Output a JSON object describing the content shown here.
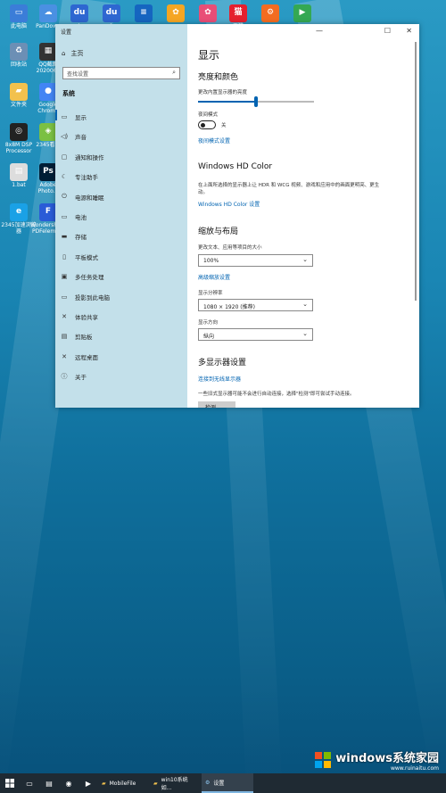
{
  "desktop": {
    "icons": [
      {
        "label": "此电脑",
        "icon": "computer-icon",
        "color": "#3b7dd8"
      },
      {
        "label": "PanDown",
        "icon": "cloud-icon",
        "color": "#4a90e2"
      },
      {
        "label": "du",
        "icon": "baidu-icon",
        "color": "#2e67d1"
      },
      {
        "label": "du",
        "icon": "baidu-icon",
        "color": "#2e67d1"
      },
      {
        "label": "",
        "icon": "stack-icon",
        "color": "#1565c0"
      },
      {
        "label": "",
        "icon": "app-icon",
        "color": "#f5a623"
      },
      {
        "label": "",
        "icon": "app-icon",
        "color": "#e94e77"
      },
      {
        "label": "天猫",
        "icon": "tmall-icon",
        "color": "#e5202e"
      },
      {
        "label": "",
        "icon": "gear-icon",
        "color": "#f36c21"
      },
      {
        "label": "",
        "icon": "play-icon",
        "color": "#34a853"
      },
      {
        "label": "回收站",
        "icon": "recycle-bin-icon",
        "color": "#6c8fb5"
      },
      {
        "label": "QQ截图 2020061",
        "icon": "image-icon",
        "color": "#333"
      },
      {
        "label": "文件夹",
        "icon": "folder-icon",
        "color": "#f2c14e"
      },
      {
        "label": "Google Chrome",
        "icon": "chrome-icon",
        "color": "#4285f4"
      },
      {
        "label": "8x8M DSP Processor",
        "icon": "speaker-icon",
        "color": "#222"
      },
      {
        "label": "2345看图",
        "icon": "photo-viewer-icon",
        "color": "#7bc043"
      },
      {
        "label": "1.bat",
        "icon": "bat-file-icon",
        "color": "#ddd"
      },
      {
        "label": "Adobe Photo...",
        "icon": "photoshop-icon",
        "color": "#001e36"
      },
      {
        "label": "2345加速浏览器",
        "icon": "browser-icon",
        "color": "#1aa1e6"
      },
      {
        "label": "Wondershare PDFelement",
        "icon": "pdf-icon",
        "color": "#2a5bd7"
      }
    ]
  },
  "window": {
    "title": "设置",
    "controls": [
      "—",
      "☐",
      "✕"
    ]
  },
  "sidebar": {
    "home": "主页",
    "search_placeholder": "查找设置",
    "section": "系统",
    "items": [
      {
        "label": "显示",
        "icon": "display-icon",
        "selected": true
      },
      {
        "label": "声音",
        "icon": "sound-icon"
      },
      {
        "label": "通知和操作",
        "icon": "notification-icon"
      },
      {
        "label": "专注助手",
        "icon": "moon-icon"
      },
      {
        "label": "电源和睡眠",
        "icon": "power-icon"
      },
      {
        "label": "电池",
        "icon": "battery-icon"
      },
      {
        "label": "存储",
        "icon": "storage-icon"
      },
      {
        "label": "平板模式",
        "icon": "tablet-icon"
      },
      {
        "label": "多任务处理",
        "icon": "multitask-icon"
      },
      {
        "label": "投影到此电脑",
        "icon": "project-icon"
      },
      {
        "label": "体验共享",
        "icon": "share-icon"
      },
      {
        "label": "剪贴板",
        "icon": "clipboard-icon"
      },
      {
        "label": "远程桌面",
        "icon": "remote-desktop-icon"
      },
      {
        "label": "关于",
        "icon": "info-icon"
      }
    ]
  },
  "main": {
    "title": "显示",
    "brightness_heading": "亮度和颜色",
    "brightness_label": "更改内置显示器的亮度",
    "brightness_level": 0.5,
    "night_light_label": "夜间模式",
    "night_light_state": "关",
    "night_light_link": "夜间模式设置",
    "hdr_heading": "Windows HD Color",
    "hdr_desc": "在上面所选择的显示器上让 HDR 和 WCG 视频、游戏和应用中的画面更明亮、更生动。",
    "hdr_link": "Windows HD Color 设置",
    "scale_heading": "缩放与布局",
    "scale_label": "更改文本、应用等项目的大小",
    "scale_value": "100%",
    "scale_link": "高级缩放设置",
    "resolution_label": "显示分辨率",
    "resolution_value": "1080 × 1920 (推荐)",
    "orientation_label": "显示方向",
    "orientation_value": "纵向",
    "multi_heading": "多显示器设置",
    "multi_link": "连接到无线显示器",
    "multi_desc": "一些旧式显示器可能不会进行自动连接，选择\"检测\"即可尝试手动连接。",
    "detect_button": "检测"
  },
  "taskbar": {
    "apps": [
      {
        "label": "MobileFile",
        "icon": "folder-icon"
      },
      {
        "label": "win10系统如...",
        "icon": "folder-icon"
      },
      {
        "label": "设置",
        "icon": "gear-icon",
        "active": true
      }
    ]
  },
  "watermark": {
    "text": "windows系统家园",
    "url": "www.ruinaitu.com"
  }
}
